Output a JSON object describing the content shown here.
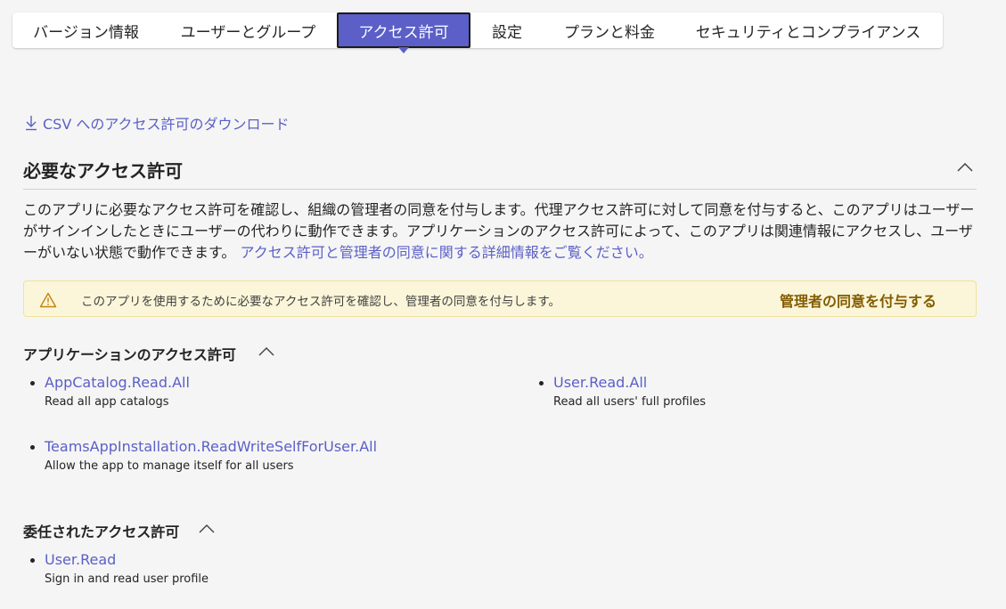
{
  "tabs": [
    {
      "label": "バージョン情報"
    },
    {
      "label": "ユーザーとグループ"
    },
    {
      "label": "アクセス許可"
    },
    {
      "label": "設定"
    },
    {
      "label": "プランと料金"
    },
    {
      "label": "セキュリティとコンプライアンス"
    }
  ],
  "active_tab_index": 2,
  "download_link": "CSV へのアクセス許可のダウンロード",
  "required": {
    "title": "必要なアクセス許可",
    "description": "このアプリに必要なアクセス許可を確認し、組織の管理者の同意を付与します。代理アクセス許可に対して同意を付与すると、このアプリはユーザーがサインインしたときにユーザーの代わりに動作できます。アプリケーションのアクセス許可によって、このアプリは関連情報にアクセスし、ユーザーがいない状態で動作できます。",
    "learn_more_link": "アクセス許可と管理者の同意に関する詳細情報をご覧ください。"
  },
  "warning": {
    "text": "このアプリを使用するために必要なアクセス許可を確認し、管理者の同意を付与します。",
    "button_label": "管理者の同意を付与する"
  },
  "application_permissions": {
    "title": "アプリケーションのアクセス許可",
    "items": [
      {
        "name": "AppCatalog.Read.All",
        "description": "Read all app catalogs"
      },
      {
        "name": "User.Read.All",
        "description": "Read all users' full profiles"
      },
      {
        "name": "TeamsAppInstallation.ReadWriteSelfForUser.All",
        "description": "Allow the app to manage itself for all users"
      }
    ]
  },
  "delegated_permissions": {
    "title": "委任されたアクセス許可",
    "items": [
      {
        "name": "User.Read",
        "description": "Sign in and read user profile"
      }
    ]
  },
  "colors": {
    "accent": "#5b5fc7",
    "warning_background": "#fbf6d9",
    "warning_button": "#835b00",
    "page_background": "#f5f5f5"
  },
  "icons": {
    "download": "download-arrow-icon",
    "collapse": "chevron-up-icon",
    "warning": "warning-triangle-icon"
  }
}
